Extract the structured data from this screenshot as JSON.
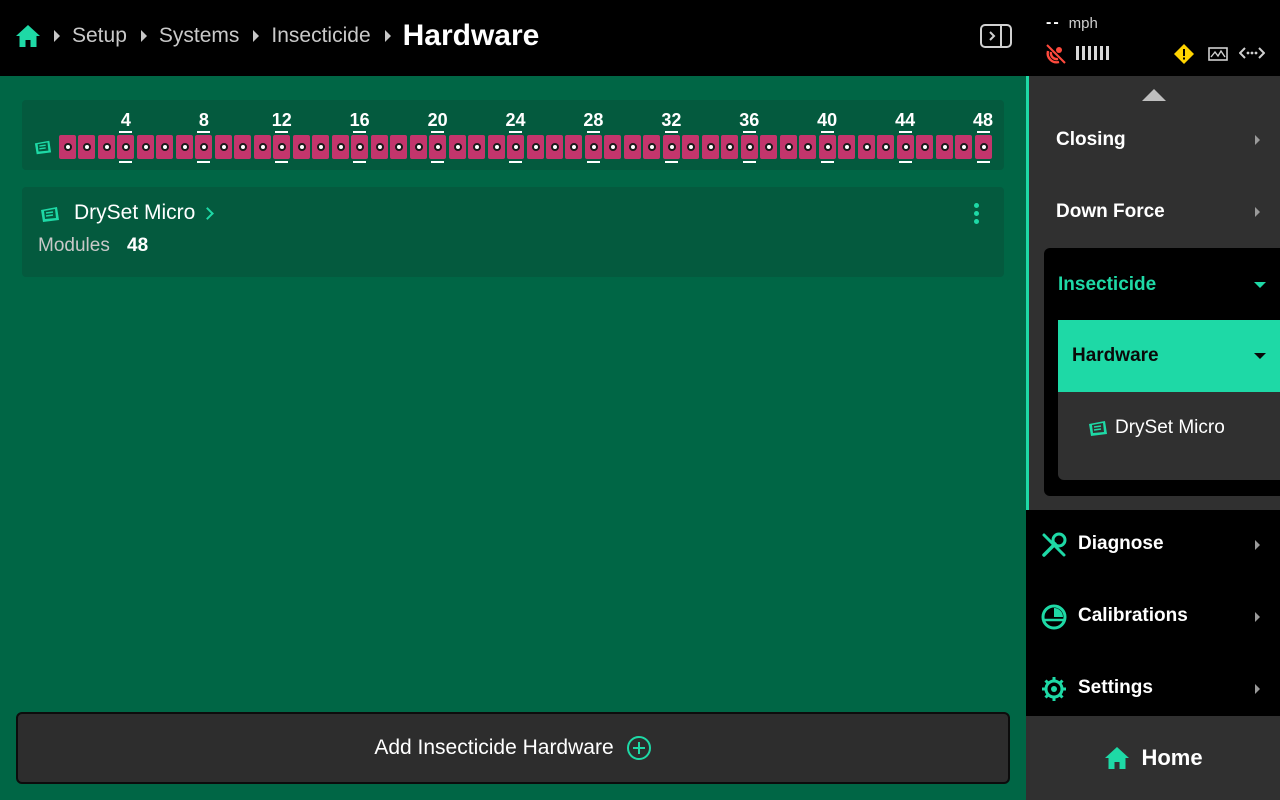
{
  "breadcrumb": {
    "items": [
      "Setup",
      "Systems",
      "Insecticide"
    ],
    "current": "Hardware"
  },
  "status": {
    "speed_value": "--",
    "speed_unit": "mph"
  },
  "row_bar": {
    "total_rows": 48,
    "labels": [
      "4",
      "8",
      "12",
      "16",
      "20",
      "24",
      "28",
      "32",
      "36",
      "40",
      "44",
      "48"
    ]
  },
  "hardware_card": {
    "name": "DrySet Micro",
    "modules_label": "Modules",
    "modules_value": "48"
  },
  "add_button": {
    "label": "Add Insecticide Hardware"
  },
  "side_nav": {
    "items": [
      {
        "label": "Closing"
      },
      {
        "label": "Down Force"
      }
    ],
    "expanded": {
      "label": "Insecticide",
      "selected": "Hardware",
      "sub_item": "DrySet Micro"
    },
    "bottom_items": [
      {
        "label": "Diagnose",
        "icon": "wrench-screwdriver-icon"
      },
      {
        "label": "Calibrations",
        "icon": "gauge-icon"
      },
      {
        "label": "Settings",
        "icon": "gear-icon"
      }
    ],
    "home_label": "Home"
  },
  "colors": {
    "accent": "#1ed9a6",
    "main_bg": "#006645",
    "card_bg": "#045a3e",
    "row_cell": "#c3356c"
  }
}
